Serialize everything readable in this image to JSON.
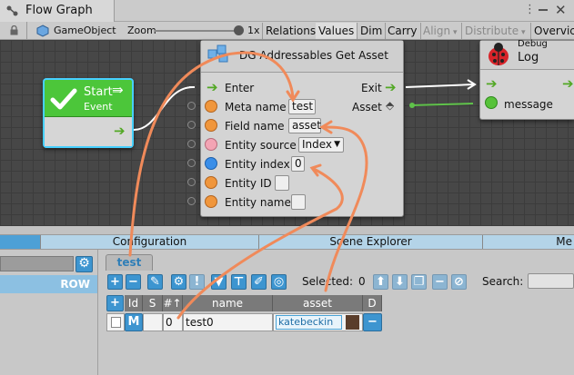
{
  "window": {
    "title": "Flow Graph"
  },
  "toolbar": {
    "context": "GameObject",
    "zoom_label": "Zoom",
    "zoom_value": "1x",
    "buttons": {
      "relations": "Relations",
      "values": "Values",
      "dim": "Dim",
      "carry": "Carry",
      "align": "Align",
      "distribute": "Distribute",
      "overview": "Overvic"
    }
  },
  "nodes": {
    "start": {
      "title": "Start",
      "subtitle": "Event"
    },
    "get_asset": {
      "title": "DG Addressables Get Asset",
      "ports": {
        "enter": "Enter",
        "exit": "Exit",
        "asset": "Asset"
      },
      "fields": {
        "meta_name_label": "Meta name",
        "meta_name_value": "test",
        "field_name_label": "Field name",
        "field_name_value": "asset",
        "entity_source_label": "Entity source",
        "entity_source_value": "Index",
        "entity_index_label": "Entity index",
        "entity_index_value": "0",
        "entity_id_label": "Entity ID",
        "entity_id_value": "",
        "entity_name_label": "Entity name",
        "entity_name_value": ""
      }
    },
    "debug_log": {
      "category": "Debug",
      "title": "Log",
      "port_message": "message"
    }
  },
  "tabs": {
    "configuration": "Configuration",
    "scene_explorer": "Scene Explorer",
    "more": "Me"
  },
  "left_panel": {
    "row_label": "ROW"
  },
  "meta_tab": "test",
  "table_toolbar": {
    "selected_label": "Selected:",
    "selected_count": "0",
    "search_label": "Search:",
    "search_value": ""
  },
  "table": {
    "headers": {
      "add": "+",
      "id": "Id",
      "s": "S",
      "order": "#↑",
      "name": "name",
      "asset": "asset",
      "d": "D"
    },
    "rows": [
      {
        "m": "M",
        "order": "0",
        "name": "test0",
        "asset": "katebeckin"
      }
    ]
  },
  "colors": {
    "start_green": "#4cc63a",
    "orange_port": "#f0963c",
    "blue_port": "#3a8ee8",
    "pink_port": "#f3a4b4",
    "annotation": "#f08a5a",
    "blue_button": "#3d95d0"
  }
}
